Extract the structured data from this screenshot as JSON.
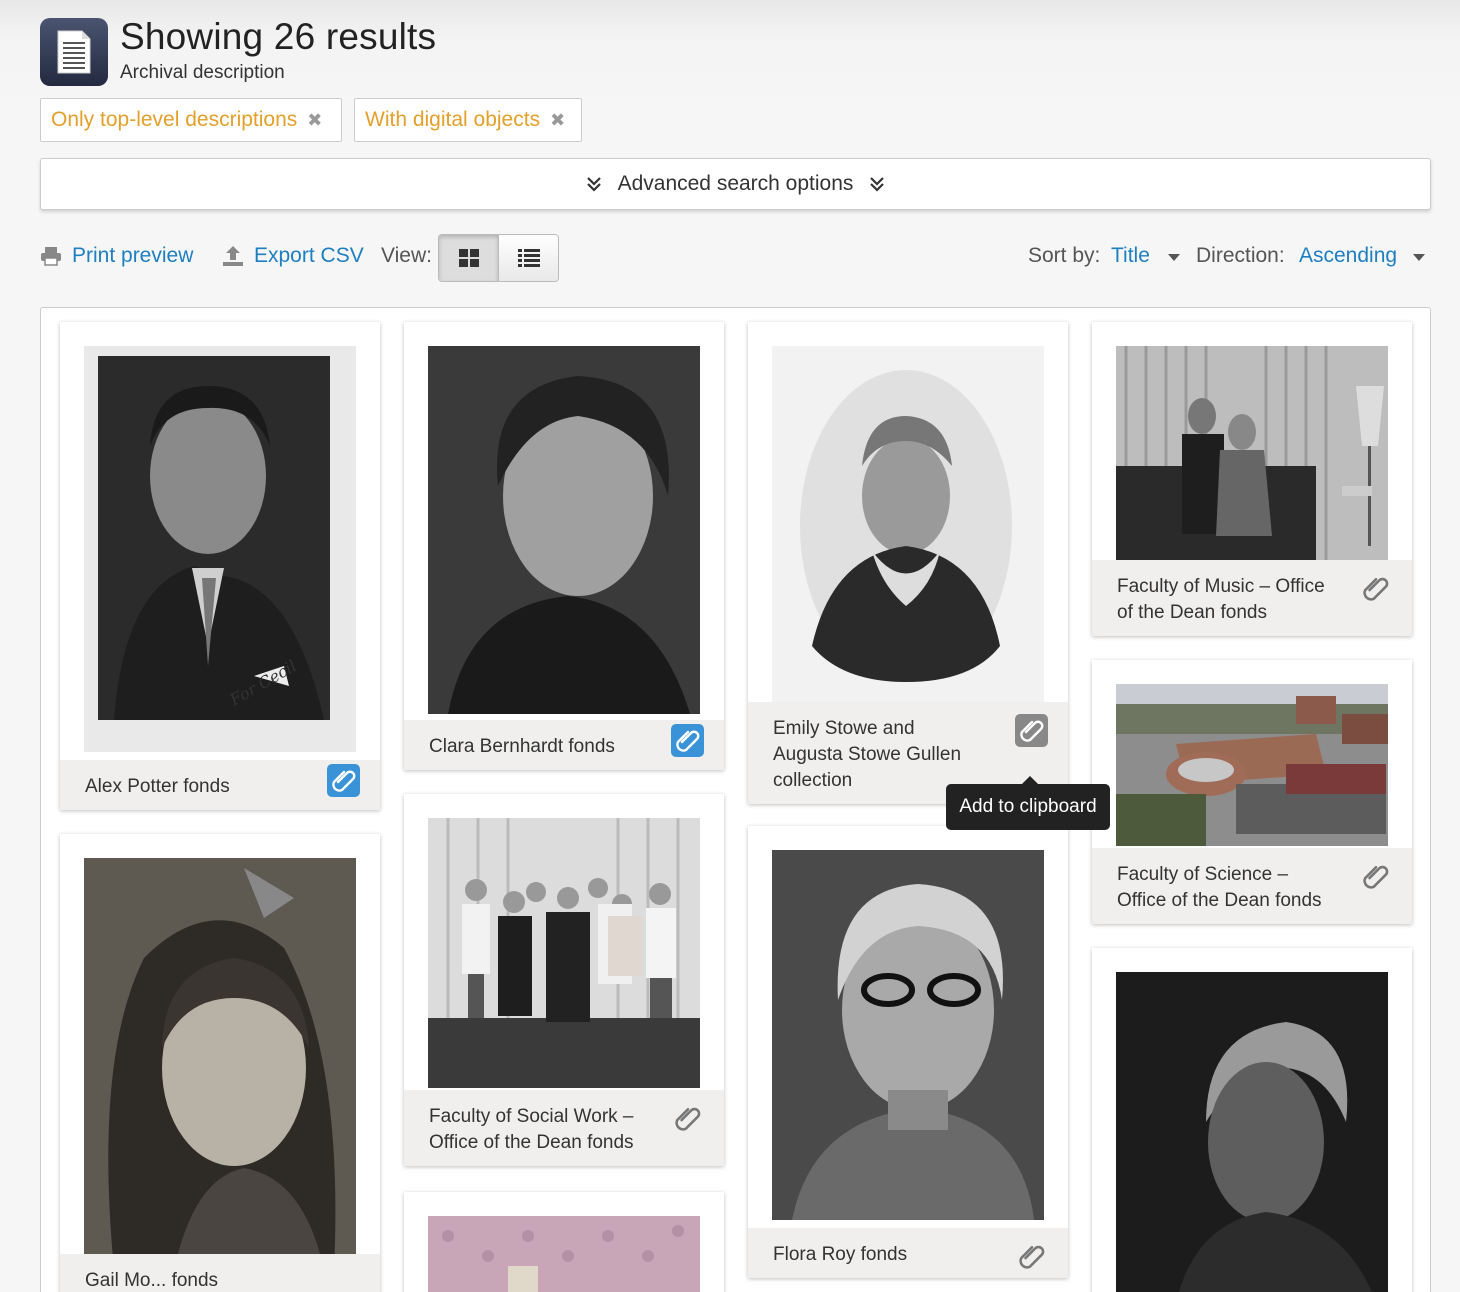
{
  "header": {
    "title": "Showing 26 results",
    "subtitle": "Archival description"
  },
  "filters": [
    {
      "label": "Only top-level descriptions",
      "remove": "✖"
    },
    {
      "label": "With digital objects",
      "remove": "✖"
    }
  ],
  "advanced": {
    "label": "Advanced search options"
  },
  "toolbar": {
    "print_label": "Print preview",
    "export_label": "Export CSV",
    "view_label": "View:",
    "sort_label": "Sort by:",
    "sort_value": "Title",
    "direction_label": "Direction:",
    "direction_value": "Ascending"
  },
  "results": [
    {
      "title": "Alex Potter fonds",
      "clipboard_state": "added",
      "thumb": "portrait of man in suit"
    },
    {
      "title": "Clara Bernhardt fonds",
      "clipboard_state": "added",
      "thumb": "portrait of woman"
    },
    {
      "title": "Emily Stowe and Augusta Stowe Gullen collection",
      "clipboard_state": "hover",
      "thumb": "oval portrait of woman"
    },
    {
      "title": "Faculty of Music – Office of the Dean fonds",
      "clipboard_state": "none",
      "thumb": "couple on sofa"
    },
    {
      "title": "Gail Mo... fonds",
      "clipboard_state": "none",
      "thumb": "portrait of girl with bow"
    },
    {
      "title": "Faculty of Social Work – Office of the Dean fonds",
      "clipboard_state": "none",
      "thumb": "group photo"
    },
    {
      "title": "Flora Roy fonds",
      "clipboard_state": "none",
      "thumb": "portrait of woman with glasses"
    },
    {
      "title": "Faculty of Science – Office of the Dean fonds",
      "clipboard_state": "none",
      "thumb": "aerial campus view"
    }
  ],
  "tooltip": {
    "text": "Add to clipboard"
  },
  "colors": {
    "link": "#1e7fc0",
    "filter": "#e3a02a",
    "clip_active": "#3a93d6"
  }
}
